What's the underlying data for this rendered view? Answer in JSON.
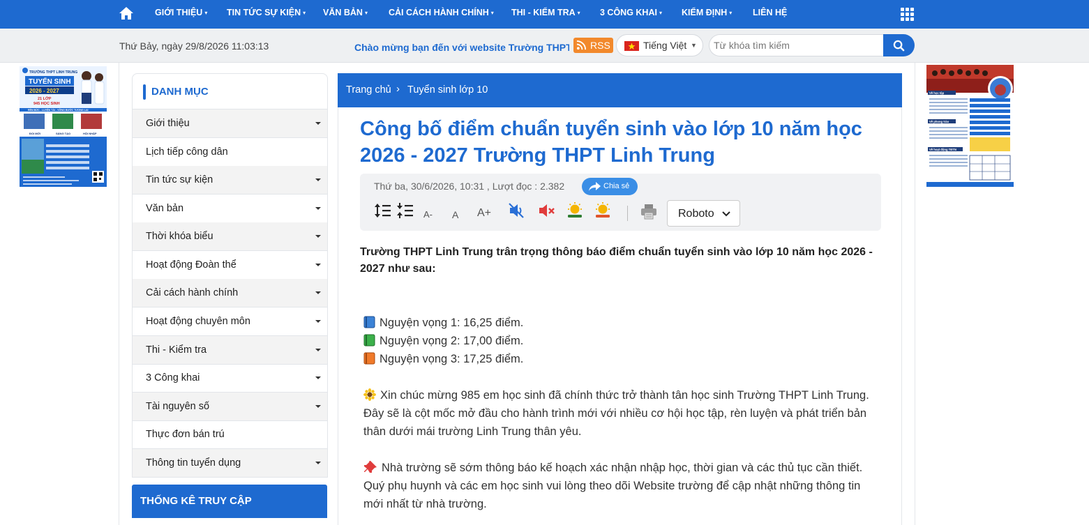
{
  "nav": {
    "items": [
      {
        "label": "GIỚI THIỆU",
        "has_dropdown": true
      },
      {
        "label": "TIN TỨC SỰ KIỆN",
        "has_dropdown": true
      },
      {
        "label": "VĂN BẢN",
        "has_dropdown": true
      },
      {
        "label": "CẢI CÁCH HÀNH CHÍNH",
        "has_dropdown": true
      },
      {
        "label": "THI - KIỂM TRA",
        "has_dropdown": true
      },
      {
        "label": "3 CÔNG KHAI",
        "has_dropdown": true
      },
      {
        "label": "KIỂM ĐỊNH",
        "has_dropdown": true
      },
      {
        "label": "LIÊN HỆ",
        "has_dropdown": false
      }
    ],
    "caret": "▾",
    "home_icon": "home-icon",
    "menu_icon": "grid-menu-icon"
  },
  "subbar": {
    "datetime": "Thứ Bảy, ngày 29/8/2026 11:03:13",
    "marquee": "Chào mừng bạn đến với website Trường THPT Linh Trung",
    "rss_label": "RSS",
    "language": "Tiếng Việt",
    "search_placeholder": "Từ khóa tìm kiếm"
  },
  "sidebar": {
    "title": "DANH MỤC",
    "items": [
      {
        "label": "Giới thiệu",
        "has_dropdown": true
      },
      {
        "label": "Lịch tiếp công dân",
        "has_dropdown": false
      },
      {
        "label": "Tin tức sự kiện",
        "has_dropdown": true
      },
      {
        "label": "Văn bản",
        "has_dropdown": true
      },
      {
        "label": "Thời khóa biểu",
        "has_dropdown": true
      },
      {
        "label": "Hoạt động Đoàn thể",
        "has_dropdown": true
      },
      {
        "label": "Cải cách hành chính",
        "has_dropdown": true
      },
      {
        "label": "Hoạt động chuyên môn",
        "has_dropdown": true
      },
      {
        "label": "Thi - Kiểm tra",
        "has_dropdown": true
      },
      {
        "label": "3 Công khai",
        "has_dropdown": true
      },
      {
        "label": "Tài nguyên số",
        "has_dropdown": true
      },
      {
        "label": "Thực đơn bán trú",
        "has_dropdown": false
      },
      {
        "label": "Thông tin tuyển dụng",
        "has_dropdown": true
      }
    ],
    "stats_title": "THỐNG KÊ TRUY CẬP"
  },
  "breadcrumb": {
    "home": "Trang chủ",
    "separator": "›",
    "current": "Tuyển sinh lớp 10"
  },
  "article": {
    "title": "Công bố điểm chuẩn tuyển sinh vào lớp 10 năm học 2026 - 2027 Trường THPT Linh Trung",
    "meta": "Thứ ba, 30/6/2026, 10:31 , Lượt đọc : 2.382",
    "share_label": "Chia sẻ",
    "tools": {
      "font_decrease": "A-",
      "font_normal": "A",
      "font_increase": "A+",
      "font_family": "Roboto"
    },
    "intro": "Trường THPT Linh Trung trân trọng thông báo điểm chuẩn tuyển sinh vào lớp 10 năm học 2026 - 2027 như sau:",
    "scores": [
      {
        "icon": "blue-book-icon",
        "text": "Nguyện vọng 1: 16,25 điểm."
      },
      {
        "icon": "green-book-icon",
        "text": "Nguyện vọng 2: 17,00 điểm."
      },
      {
        "icon": "orange-book-icon",
        "text": "Nguyện vọng 3: 17,25 điểm."
      }
    ],
    "congrats": "Xin chúc mừng 985 em học sinh đã chính thức trở thành tân học sinh Trường THPT Linh Trung. Đây sẽ là cột mốc mở đầu cho hành trình mới với nhiều cơ hội học tập, rèn luyện và phát triển bản thân dưới mái trường Linh Trung thân yêu.",
    "notice": "Nhà trường sẽ sớm thông báo kế hoạch xác nhận nhập học, thời gian và các thủ tục cần thiết. Quý phụ huynh và các em học sinh vui lòng theo dõi Website trường để cập nhật những thông tin mới nhất từ nhà trường."
  },
  "banners": {
    "left": {
      "school": "TRƯỜNG THPT LINH TRUNG",
      "headline": "TUYỂN SINH",
      "years": "2026 - 2027",
      "classes": "21 LỚP",
      "students": "945 HỌC SINH",
      "slogan": "RÈN ĐỨC - LUYỆN TÀI - VỮNG BƯỚC TƯƠNG LAI",
      "tags": [
        "ĐỔI MỚI",
        "SÁNG TẠO",
        "HỘI NHẬP"
      ]
    },
    "right": {
      "sections": [
        "Về học tập",
        "Về phong trào",
        "Về hoạt động TĐTN"
      ]
    }
  },
  "colors": {
    "primary": "#1e6ad0",
    "rss": "#f2892c",
    "share": "#3a8ee6",
    "subbar_bg": "#eef0f2"
  }
}
